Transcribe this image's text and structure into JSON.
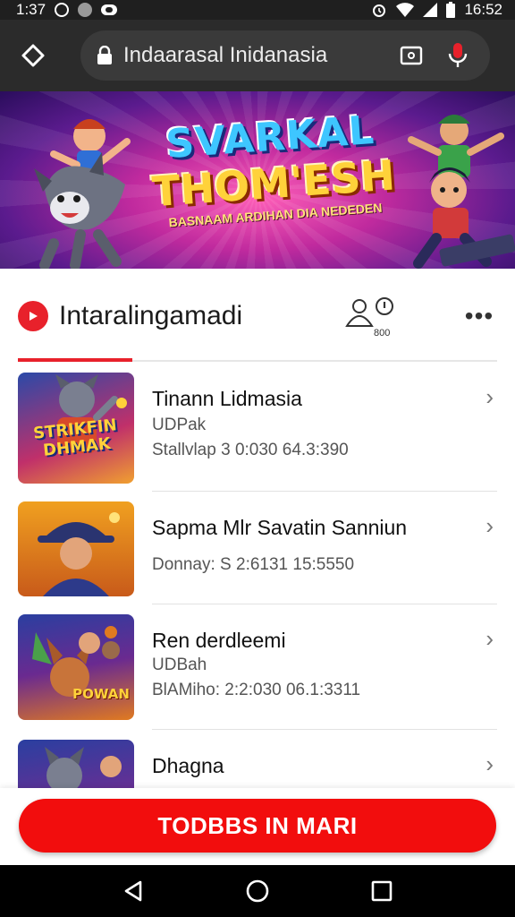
{
  "status_bar": {
    "time": "1:37",
    "right_time": "16:52",
    "left_icons": [
      "alarm-icon",
      "record-icon",
      "notification-icon"
    ],
    "right_icons": [
      "alarm-clock-icon",
      "wifi-icon",
      "signal-icon",
      "battery-icon"
    ]
  },
  "browser": {
    "url": "Indaarasal Inidanasia",
    "icons": [
      "home-icon",
      "lock-icon",
      "tab-switcher-icon",
      "voice-icon"
    ]
  },
  "banner": {
    "title_line1": "SVARKAL -",
    "title_line2": "THOM'ESH",
    "subtitle": "BASNAAM ARDIHAN DIA NEDEDEN"
  },
  "channel": {
    "name": "Intaralingamadi",
    "subscriber_count": "800",
    "more_label": "•••"
  },
  "videos": [
    {
      "title": "Tinann Lidmasia",
      "line2": "UDPak",
      "line3": "Stallvlap 3 0:030 64.3:390",
      "thumb_label": "STRIKFIN DHMAK"
    },
    {
      "title": "Sapma Mlr Savatin Sanniun",
      "line2": "Donnay: S 2:6131 15:5550",
      "line3": "",
      "thumb_label": ""
    },
    {
      "title": "Ren derdleemi",
      "line2": "UDBah",
      "line3": "BlAMiho: 2:2:030 06.1:3311",
      "thumb_label": "POWAN"
    },
    {
      "title": "Dhagna",
      "line2": "",
      "line3": "",
      "thumb_label": ""
    }
  ],
  "cta": {
    "label": "TODBBS IN MARI"
  },
  "colors": {
    "accent": "#e8212b",
    "cta": "#f20d0d",
    "topbar": "#2b2b2b"
  }
}
